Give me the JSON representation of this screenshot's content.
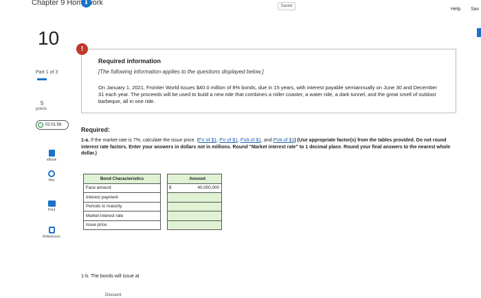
{
  "header": {
    "title": "Chapter 9 Homework",
    "saved": "Saved",
    "help": "Help",
    "save": "Sav"
  },
  "question": {
    "number": "10",
    "part": "Part 1 of 3",
    "points_value": "5",
    "points_label": "points",
    "timer": "02:01:58"
  },
  "tools": {
    "ebook": "eBook",
    "hint": "Hint",
    "print": "Print",
    "references": "References"
  },
  "info": {
    "heading": "Required information",
    "subheading": "[The following information applies to the questions displayed below.]",
    "paragraph": "On January 1, 2021, Frontier World issues $40.0 million of 8% bonds, due in 15 years, with interest payable semiannually on June 30 and December 31 each year. The proceeds will be used to build a new ride that combines a roller coaster, a water ride, a dark tunnel, and the great smell of outdoor barbeque, all in one ride."
  },
  "required": {
    "heading": "Required:",
    "prefix": "1-a.",
    "text_1": " If the market rate is 7%, calculate the issue price. (",
    "link_fv": "FV of $1",
    "link_pv": "PV of $1",
    "link_fva": "FVA of $1",
    "link_pva": "PVA of $1",
    "sep_1": ", ",
    "sep_and": ", and ",
    "text_2": ") (Use appropriate factor(s) from the tables provided. Do not round interest rate factors. Enter your answers in dollars not in millions. Round \"Market interest rate\" to 1 decimal place. Round your final answers to the nearest whole dollar.)"
  },
  "table": {
    "header_1": "Bond Characteristics",
    "header_2": "Amount",
    "rows": [
      {
        "label": "Face amount",
        "currency": "$",
        "value": "40,000,000"
      },
      {
        "label": "Interest payment",
        "currency": "",
        "value": ""
      },
      {
        "label": "Periods to maturity",
        "currency": "",
        "value": ""
      },
      {
        "label": "Market interest rate",
        "currency": "",
        "value": ""
      },
      {
        "label": "Issue price",
        "currency": "",
        "value": ""
      }
    ]
  },
  "part_b": {
    "text": "1-b. The bonds will issue at",
    "partial": "Discount"
  },
  "colors": {
    "accent": "#1a73c8",
    "alert": "#c0392b",
    "answer_bg": "#dff2d4"
  }
}
